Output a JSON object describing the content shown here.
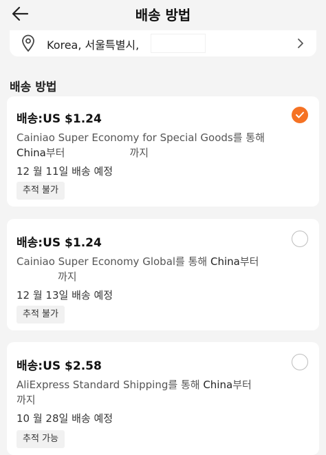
{
  "header": {
    "title": "배송 방법",
    "back_icon": "arrow-left-icon"
  },
  "address": {
    "text": "Korea, 서울특별시,",
    "pin_icon": "location-pin-icon",
    "chevron_icon": "chevron-right-icon"
  },
  "section": {
    "title": "배송 방법"
  },
  "accent_color": "#f57224",
  "options": [
    {
      "price": "배송:US $1.24",
      "desc_line1": "Cainiao Super Economy for Special Goods를 통해",
      "desc_from": "China",
      "desc_from_suffix": "부터",
      "desc_to_suffix": "까지",
      "date": "12 월 11일 배송 예정",
      "tracking": "추적 불가",
      "selected": true
    },
    {
      "price": "배송:US $1.24",
      "desc_line1": "Cainiao Super Economy Global를 통해 ",
      "desc_from": "China",
      "desc_from_suffix": "부터",
      "desc_to_suffix": "까지",
      "date": "12 월 13일 배송 예정",
      "tracking": "추적 불가",
      "selected": false
    },
    {
      "price": "배송:US $2.58",
      "desc_line1": "AliExpress Standard Shipping를 통해 ",
      "desc_from": "China",
      "desc_from_suffix": "부터",
      "desc_to_suffix": "까지",
      "date": "10 월 28일 배송 예정",
      "tracking": "추적 가능",
      "selected": false
    }
  ]
}
